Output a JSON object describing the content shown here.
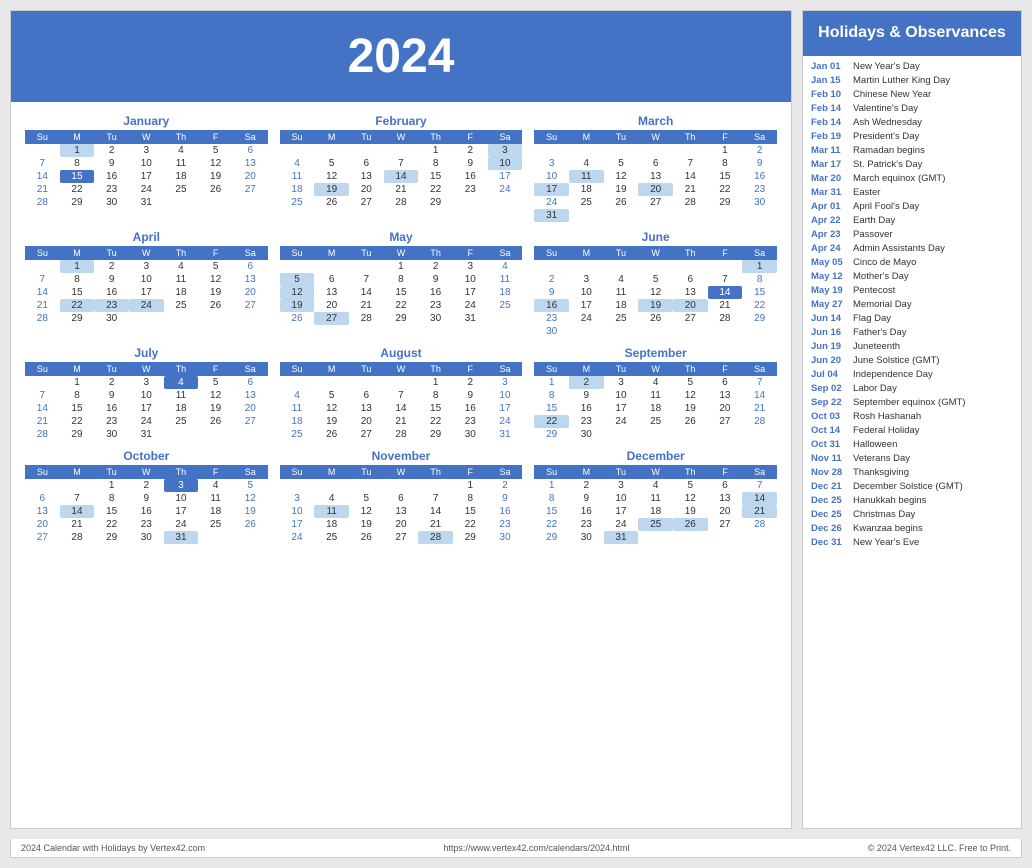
{
  "year": "2024",
  "title": "Holidays & Observances",
  "footer": {
    "left": "2024 Calendar with Holidays by Vertex42.com",
    "center": "https://www.vertex42.com/calendars/2024.html",
    "right": "© 2024 Vertex42 LLC. Free to Print."
  },
  "months": [
    {
      "name": "January",
      "days": [
        [
          null,
          1,
          2,
          3,
          4,
          5,
          6
        ],
        [
          7,
          8,
          9,
          10,
          11,
          12,
          13
        ],
        [
          14,
          15,
          16,
          17,
          18,
          19,
          20
        ],
        [
          21,
          22,
          23,
          24,
          25,
          26,
          27
        ],
        [
          28,
          29,
          30,
          31,
          null,
          null,
          null
        ]
      ],
      "highlights": {
        "1": "blue",
        "15": "dark"
      }
    },
    {
      "name": "February",
      "days": [
        [
          null,
          null,
          null,
          null,
          1,
          2,
          3
        ],
        [
          4,
          5,
          6,
          7,
          8,
          9,
          10
        ],
        [
          11,
          12,
          13,
          14,
          15,
          16,
          17
        ],
        [
          18,
          19,
          20,
          21,
          22,
          23,
          24
        ],
        [
          25,
          26,
          27,
          28,
          29,
          null,
          null
        ]
      ],
      "highlights": {
        "3": "blue",
        "10": "blue",
        "14": "blue",
        "19": "blue"
      }
    },
    {
      "name": "March",
      "days": [
        [
          null,
          null,
          null,
          null,
          null,
          1,
          2
        ],
        [
          3,
          4,
          5,
          6,
          7,
          8,
          9
        ],
        [
          10,
          11,
          12,
          13,
          14,
          15,
          16
        ],
        [
          17,
          18,
          19,
          20,
          21,
          22,
          23
        ],
        [
          24,
          25,
          26,
          27,
          28,
          29,
          30
        ],
        [
          31,
          null,
          null,
          null,
          null,
          null,
          null
        ]
      ],
      "highlights": {
        "11": "blue",
        "17": "blue",
        "20": "blue",
        "31": "blue"
      }
    },
    {
      "name": "April",
      "days": [
        [
          null,
          1,
          2,
          3,
          4,
          5,
          6
        ],
        [
          7,
          8,
          9,
          10,
          11,
          12,
          13
        ],
        [
          14,
          15,
          16,
          17,
          18,
          19,
          20
        ],
        [
          21,
          22,
          23,
          24,
          25,
          26,
          27
        ],
        [
          28,
          29,
          30,
          null,
          null,
          null,
          null
        ]
      ],
      "highlights": {
        "1": "blue",
        "22": "blue",
        "23": "blue",
        "24": "blue"
      }
    },
    {
      "name": "May",
      "days": [
        [
          null,
          null,
          null,
          1,
          2,
          3,
          4
        ],
        [
          5,
          6,
          7,
          8,
          9,
          10,
          11
        ],
        [
          12,
          13,
          14,
          15,
          16,
          17,
          18
        ],
        [
          19,
          20,
          21,
          22,
          23,
          24,
          25
        ],
        [
          26,
          27,
          28,
          29,
          30,
          31,
          null
        ]
      ],
      "highlights": {
        "5": "blue",
        "12": "blue",
        "19": "blue",
        "27": "blue"
      }
    },
    {
      "name": "June",
      "days": [
        [
          null,
          null,
          null,
          null,
          null,
          null,
          1
        ],
        [
          2,
          3,
          4,
          5,
          6,
          7,
          8
        ],
        [
          9,
          10,
          11,
          12,
          13,
          14,
          15
        ],
        [
          16,
          17,
          18,
          19,
          20,
          21,
          22
        ],
        [
          23,
          24,
          25,
          26,
          27,
          28,
          29
        ],
        [
          30,
          null,
          null,
          null,
          null,
          null,
          null
        ]
      ],
      "highlights": {
        "1": "blue",
        "14": "dark",
        "16": "blue",
        "19": "blue",
        "20": "blue"
      }
    },
    {
      "name": "July",
      "days": [
        [
          null,
          1,
          2,
          3,
          4,
          5,
          6
        ],
        [
          7,
          8,
          9,
          10,
          11,
          12,
          13
        ],
        [
          14,
          15,
          16,
          17,
          18,
          19,
          20
        ],
        [
          21,
          22,
          23,
          24,
          25,
          26,
          27
        ],
        [
          28,
          29,
          30,
          31,
          null,
          null,
          null
        ]
      ],
      "highlights": {
        "4": "dark"
      }
    },
    {
      "name": "August",
      "days": [
        [
          null,
          null,
          null,
          null,
          1,
          2,
          3
        ],
        [
          4,
          5,
          6,
          7,
          8,
          9,
          10
        ],
        [
          11,
          12,
          13,
          14,
          15,
          16,
          17
        ],
        [
          18,
          19,
          20,
          21,
          22,
          23,
          24
        ],
        [
          25,
          26,
          27,
          28,
          29,
          30,
          31
        ]
      ],
      "highlights": {}
    },
    {
      "name": "September",
      "days": [
        [
          1,
          2,
          3,
          4,
          5,
          6,
          7
        ],
        [
          8,
          9,
          10,
          11,
          12,
          13,
          14
        ],
        [
          15,
          16,
          17,
          18,
          19,
          20,
          21
        ],
        [
          22,
          23,
          24,
          25,
          26,
          27,
          28
        ],
        [
          29,
          30,
          null,
          null,
          null,
          null,
          null
        ]
      ],
      "highlights": {
        "2": "blue",
        "22": "blue"
      }
    },
    {
      "name": "October",
      "days": [
        [
          null,
          null,
          1,
          2,
          3,
          4,
          5
        ],
        [
          6,
          7,
          8,
          9,
          10,
          11,
          12
        ],
        [
          13,
          14,
          15,
          16,
          17,
          18,
          19
        ],
        [
          20,
          21,
          22,
          23,
          24,
          25,
          26
        ],
        [
          27,
          28,
          29,
          30,
          31,
          null,
          null
        ]
      ],
      "highlights": {
        "3": "dark",
        "14": "blue",
        "31": "blue"
      }
    },
    {
      "name": "November",
      "days": [
        [
          null,
          null,
          null,
          null,
          null,
          1,
          2
        ],
        [
          3,
          4,
          5,
          6,
          7,
          8,
          9
        ],
        [
          10,
          11,
          12,
          13,
          14,
          15,
          16
        ],
        [
          17,
          18,
          19,
          20,
          21,
          22,
          23
        ],
        [
          24,
          25,
          26,
          27,
          28,
          29,
          30
        ]
      ],
      "highlights": {
        "11": "blue",
        "28": "blue"
      }
    },
    {
      "name": "December",
      "days": [
        [
          1,
          2,
          3,
          4,
          5,
          6,
          7
        ],
        [
          8,
          9,
          10,
          11,
          12,
          13,
          14
        ],
        [
          15,
          16,
          17,
          18,
          19,
          20,
          21
        ],
        [
          22,
          23,
          24,
          25,
          26,
          27,
          28
        ],
        [
          29,
          30,
          31,
          null,
          null,
          null,
          null
        ]
      ],
      "highlights": {
        "14": "blue",
        "21": "blue",
        "25": "blue",
        "26": "blue",
        "31": "blue"
      }
    }
  ],
  "holidays": [
    {
      "date": "Jan 01",
      "name": "New Year's Day"
    },
    {
      "date": "Jan 15",
      "name": "Martin Luther King Day"
    },
    {
      "date": "Feb 10",
      "name": "Chinese New Year"
    },
    {
      "date": "Feb 14",
      "name": "Valentine's Day"
    },
    {
      "date": "Feb 14",
      "name": "Ash Wednesday"
    },
    {
      "date": "Feb 19",
      "name": "President's Day"
    },
    {
      "date": "Mar 11",
      "name": "Ramadan begins"
    },
    {
      "date": "Mar 17",
      "name": "St. Patrick's Day"
    },
    {
      "date": "Mar 20",
      "name": "March equinox (GMT)"
    },
    {
      "date": "Mar 31",
      "name": "Easter"
    },
    {
      "date": "Apr 01",
      "name": "April Fool's Day"
    },
    {
      "date": "Apr 22",
      "name": "Earth Day"
    },
    {
      "date": "Apr 23",
      "name": "Passover"
    },
    {
      "date": "Apr 24",
      "name": "Admin Assistants Day"
    },
    {
      "date": "May 05",
      "name": "Cinco de Mayo"
    },
    {
      "date": "May 12",
      "name": "Mother's Day"
    },
    {
      "date": "May 19",
      "name": "Pentecost"
    },
    {
      "date": "May 27",
      "name": "Memorial Day"
    },
    {
      "date": "Jun 14",
      "name": "Flag Day"
    },
    {
      "date": "Jun 16",
      "name": "Father's Day"
    },
    {
      "date": "Jun 19",
      "name": "Juneteenth"
    },
    {
      "date": "Jun 20",
      "name": "June Solstice (GMT)"
    },
    {
      "date": "Jul 04",
      "name": "Independence Day"
    },
    {
      "date": "Sep 02",
      "name": "Labor Day"
    },
    {
      "date": "Sep 22",
      "name": "September equinox (GMT)"
    },
    {
      "date": "Oct 03",
      "name": "Rosh Hashanah"
    },
    {
      "date": "Oct 14",
      "name": "Federal Holiday"
    },
    {
      "date": "Oct 31",
      "name": "Halloween"
    },
    {
      "date": "Nov 11",
      "name": "Veterans Day"
    },
    {
      "date": "Nov 28",
      "name": "Thanksgiving"
    },
    {
      "date": "Dec 21",
      "name": "December Solstice (GMT)"
    },
    {
      "date": "Dec 25",
      "name": "Hanukkah begins"
    },
    {
      "date": "Dec 25",
      "name": "Christmas Day"
    },
    {
      "date": "Dec 26",
      "name": "Kwanzaa begins"
    },
    {
      "date": "Dec 31",
      "name": "New Year's Eve"
    }
  ]
}
